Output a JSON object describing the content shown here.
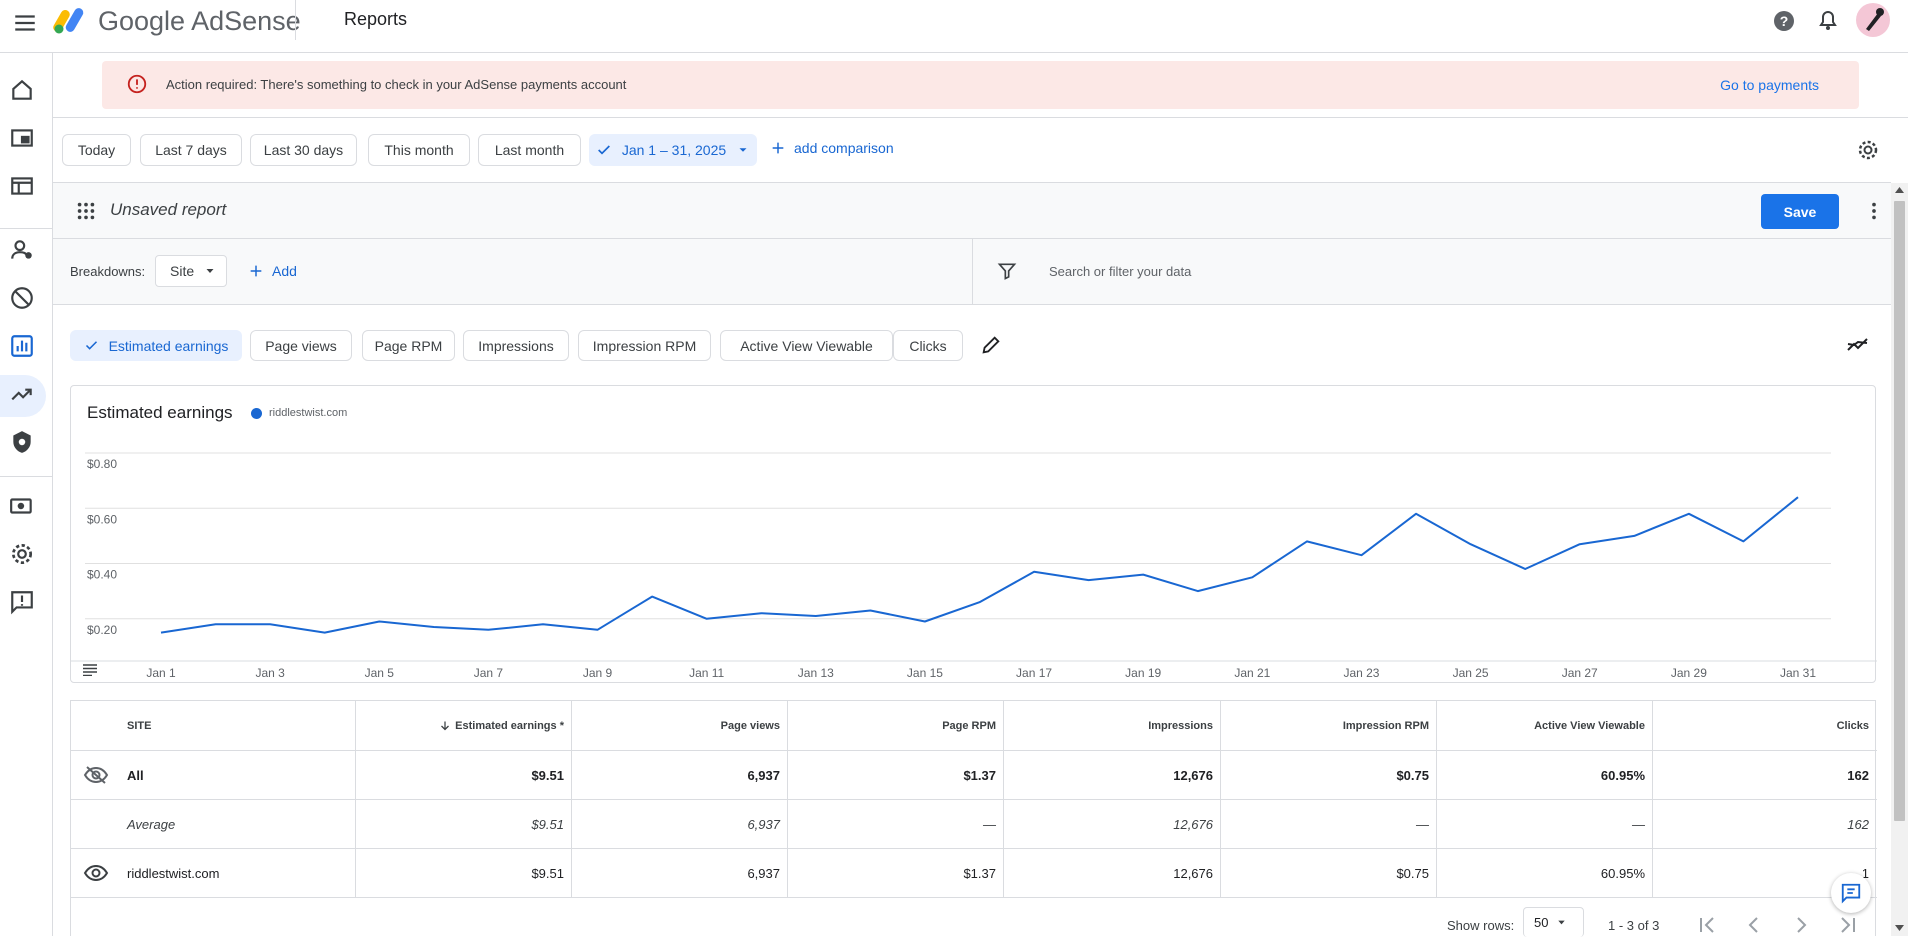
{
  "app": {
    "brand_google": "Google",
    "brand_product": "AdSense",
    "page_title": "Reports"
  },
  "alert": {
    "text": "Action required: There's something to check in your AdSense payments account",
    "link": "Go to payments"
  },
  "date_ranges": [
    "Today",
    "Last 7 days",
    "Last 30 days",
    "This month",
    "Last month"
  ],
  "selected_range": "Jan 1 – 31, 2025",
  "add_comparison": "add comparison",
  "report": {
    "title": "Unsaved report",
    "save_label": "Save"
  },
  "breakdowns": {
    "label": "Breakdowns:",
    "value": "Site",
    "add_label": "Add"
  },
  "search": {
    "placeholder": "Search or filter your data"
  },
  "metrics": [
    "Estimated earnings",
    "Page views",
    "Page RPM",
    "Impressions",
    "Impression RPM",
    "Active View Viewable",
    "Clicks"
  ],
  "selected_metric": "Estimated earnings",
  "chart_data": {
    "type": "line",
    "title": "Estimated earnings",
    "series": [
      {
        "name": "riddlestwist.com",
        "color": "#1967d2",
        "values": [
          0.15,
          0.18,
          0.18,
          0.15,
          0.19,
          0.17,
          0.16,
          0.18,
          0.16,
          0.28,
          0.2,
          0.22,
          0.21,
          0.23,
          0.19,
          0.26,
          0.37,
          0.34,
          0.36,
          0.3,
          0.35,
          0.48,
          0.43,
          0.58,
          0.47,
          0.38,
          0.47,
          0.5,
          0.58,
          0.48,
          0.64
        ]
      }
    ],
    "x": [
      "Jan 1",
      "Jan 2",
      "Jan 3",
      "Jan 4",
      "Jan 5",
      "Jan 6",
      "Jan 7",
      "Jan 8",
      "Jan 9",
      "Jan 10",
      "Jan 11",
      "Jan 12",
      "Jan 13",
      "Jan 14",
      "Jan 15",
      "Jan 16",
      "Jan 17",
      "Jan 18",
      "Jan 19",
      "Jan 20",
      "Jan 21",
      "Jan 22",
      "Jan 23",
      "Jan 24",
      "Jan 25",
      "Jan 26",
      "Jan 27",
      "Jan 28",
      "Jan 29",
      "Jan 30",
      "Jan 31"
    ],
    "x_tick_labels": [
      "Jan 1",
      "Jan 3",
      "Jan 5",
      "Jan 7",
      "Jan 9",
      "Jan 11",
      "Jan 13",
      "Jan 15",
      "Jan 17",
      "Jan 19",
      "Jan 21",
      "Jan 23",
      "Jan 25",
      "Jan 27",
      "Jan 29",
      "Jan 31"
    ],
    "y_tick_labels": [
      "$0.80",
      "$0.60",
      "$0.40",
      "$0.20"
    ],
    "y_ticks": [
      0.8,
      0.6,
      0.4,
      0.2
    ],
    "ylim": [
      0.0,
      0.8
    ],
    "grid": true,
    "legend_position": "top-left"
  },
  "table": {
    "headers": [
      "SITE",
      "Estimated earnings *",
      "Page views",
      "Page RPM",
      "Impressions",
      "Impression RPM",
      "Active View Viewable",
      "Clicks"
    ],
    "rows": [
      {
        "cells": [
          "All",
          "$9.51",
          "6,937",
          "$1.37",
          "12,676",
          "$0.75",
          "60.95%",
          "162"
        ]
      },
      {
        "cells": [
          "Average",
          "$9.51",
          "6,937",
          "—",
          "12,676",
          "—",
          "—",
          "162"
        ]
      },
      {
        "cells": [
          "riddlestwist.com",
          "$9.51",
          "6,937",
          "$1.37",
          "12,676",
          "$0.75",
          "60.95%",
          "1"
        ]
      }
    ]
  },
  "pagination": {
    "show_rows_label": "Show rows:",
    "rows_value": "50",
    "range": "1 - 3 of 3"
  }
}
